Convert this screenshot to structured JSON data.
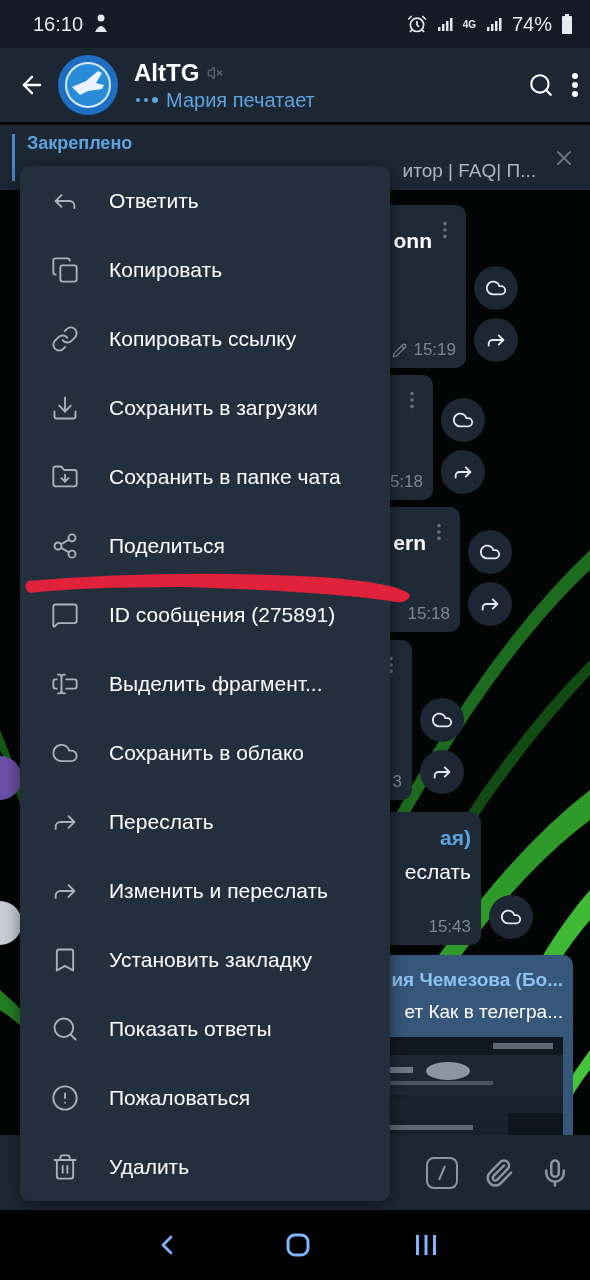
{
  "status_bar": {
    "time": "16:10",
    "network": "4G",
    "battery": "74%"
  },
  "header": {
    "title": "AltTG",
    "muted": true,
    "status": "Мария печатает"
  },
  "pinned": {
    "label": "Закреплено",
    "text": "итор | FAQ| П..."
  },
  "messages": [
    {
      "title": "onn",
      "time": "15:19",
      "edited": true,
      "avatar": false,
      "outgoing": false,
      "actions": [
        {
          "kind": "cloud"
        },
        {
          "kind": "share"
        }
      ]
    },
    {
      "time": "5:18",
      "avatar": false,
      "outgoing": false,
      "actions": [
        {
          "kind": "cloud"
        },
        {
          "kind": "share"
        }
      ]
    },
    {
      "title": "ern",
      "time": "15:18",
      "avatar": false,
      "outgoing": false,
      "actions": [
        {
          "kind": "cloud"
        },
        {
          "kind": "share"
        }
      ]
    },
    {
      "time": "3",
      "avatar": true,
      "outgoing": false,
      "actions": [
        {
          "kind": "cloud"
        },
        {
          "kind": "share"
        }
      ]
    },
    {
      "sender": "ая)",
      "text": "еслать",
      "time": "15:43",
      "avatar": true,
      "outgoing": false,
      "actions": [
        {
          "kind": "cloud"
        }
      ]
    },
    {
      "sender": "ия Чемезова (Бо...",
      "text": "ет Как в телегра...",
      "avatar": false,
      "outgoing": true
    }
  ],
  "context_menu": {
    "items": [
      "Ответить",
      "Копировать",
      "Копировать ссылку",
      "Сохранить в загрузки",
      "Сохранить в папке чата",
      "Поделиться",
      "ID сообщения (275891)",
      "Выделить фрагмент...",
      "Сохранить в облако",
      "Переслать",
      "Изменить и переслать",
      "Установить закладку",
      "Показать ответы",
      "Пожаловаться",
      "Удалить"
    ]
  }
}
